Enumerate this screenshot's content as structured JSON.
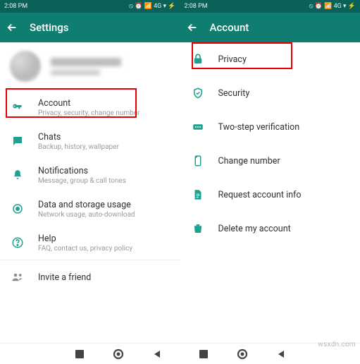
{
  "left": {
    "status_time": "2:08 PM",
    "status_icons": "⦸ ⏰ 📶 4G ▾ ⚡",
    "title": "Settings",
    "items": [
      {
        "icon": "key-icon",
        "title": "Account",
        "sub": "Privacy, security, change number"
      },
      {
        "icon": "chat-icon",
        "title": "Chats",
        "sub": "Backup, history, wallpaper"
      },
      {
        "icon": "bell-icon",
        "title": "Notifications",
        "sub": "Message, group & call tones"
      },
      {
        "icon": "data-icon",
        "title": "Data and storage usage",
        "sub": "Network usage, auto-download"
      },
      {
        "icon": "help-icon",
        "title": "Help",
        "sub": "FAQ, contact us, privacy policy"
      },
      {
        "icon": "invite-icon",
        "title": "Invite a friend",
        "sub": ""
      }
    ]
  },
  "right": {
    "status_time": "2:08 PM",
    "status_icons": "⦸ ⏰ 📶 4G ▾ ⚡",
    "title": "Account",
    "items": [
      {
        "icon": "lock-icon",
        "title": "Privacy"
      },
      {
        "icon": "shield-icon",
        "title": "Security"
      },
      {
        "icon": "twostep-icon",
        "title": "Two-step verification"
      },
      {
        "icon": "sim-icon",
        "title": "Change number"
      },
      {
        "icon": "doc-icon",
        "title": "Request account info"
      },
      {
        "icon": "trash-icon",
        "title": "Delete my account"
      }
    ]
  },
  "watermark": "wsxdn.com"
}
